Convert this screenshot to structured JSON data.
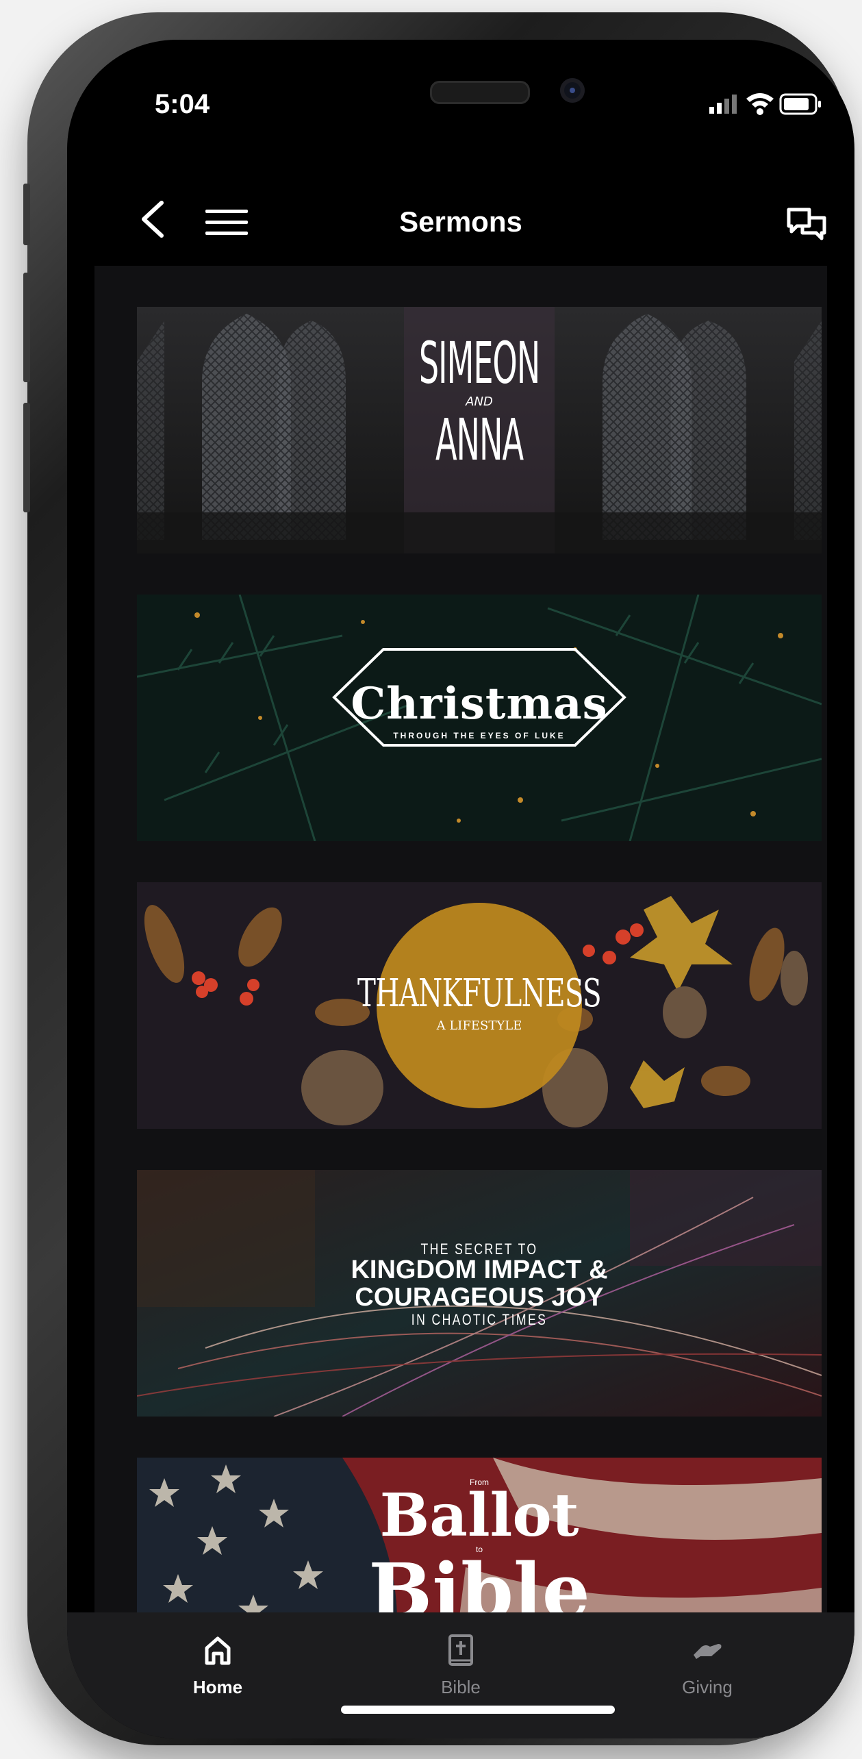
{
  "status_bar": {
    "time": "5:04"
  },
  "header": {
    "title": "Sermons"
  },
  "sermons": [
    {
      "title_line1": "SIMEON",
      "title_line2": "AND",
      "title_line3": "ANNA"
    },
    {
      "title": "Christmas",
      "subtitle": "THROUGH THE EYES OF LUKE"
    },
    {
      "title": "THANKFULNESS",
      "subtitle": "A LIFESTYLE"
    },
    {
      "line1": "THE SECRET TO",
      "line2": "KINGDOM IMPACT &",
      "line3": "COURAGEOUS JOY",
      "line4": "IN CHAOTIC TIMES"
    },
    {
      "small1": "From",
      "title1": "Ballot",
      "small2": "to",
      "title2": "Bible"
    }
  ],
  "tabs": [
    {
      "label": "Home",
      "icon": "home-icon",
      "active": true
    },
    {
      "label": "Bible",
      "icon": "bible-icon",
      "active": false
    },
    {
      "label": "Giving",
      "icon": "giving-icon",
      "active": false
    }
  ],
  "colors": {
    "active_tab": "#ffffff",
    "inactive_tab": "#8a8a8e",
    "background": "#111113"
  }
}
